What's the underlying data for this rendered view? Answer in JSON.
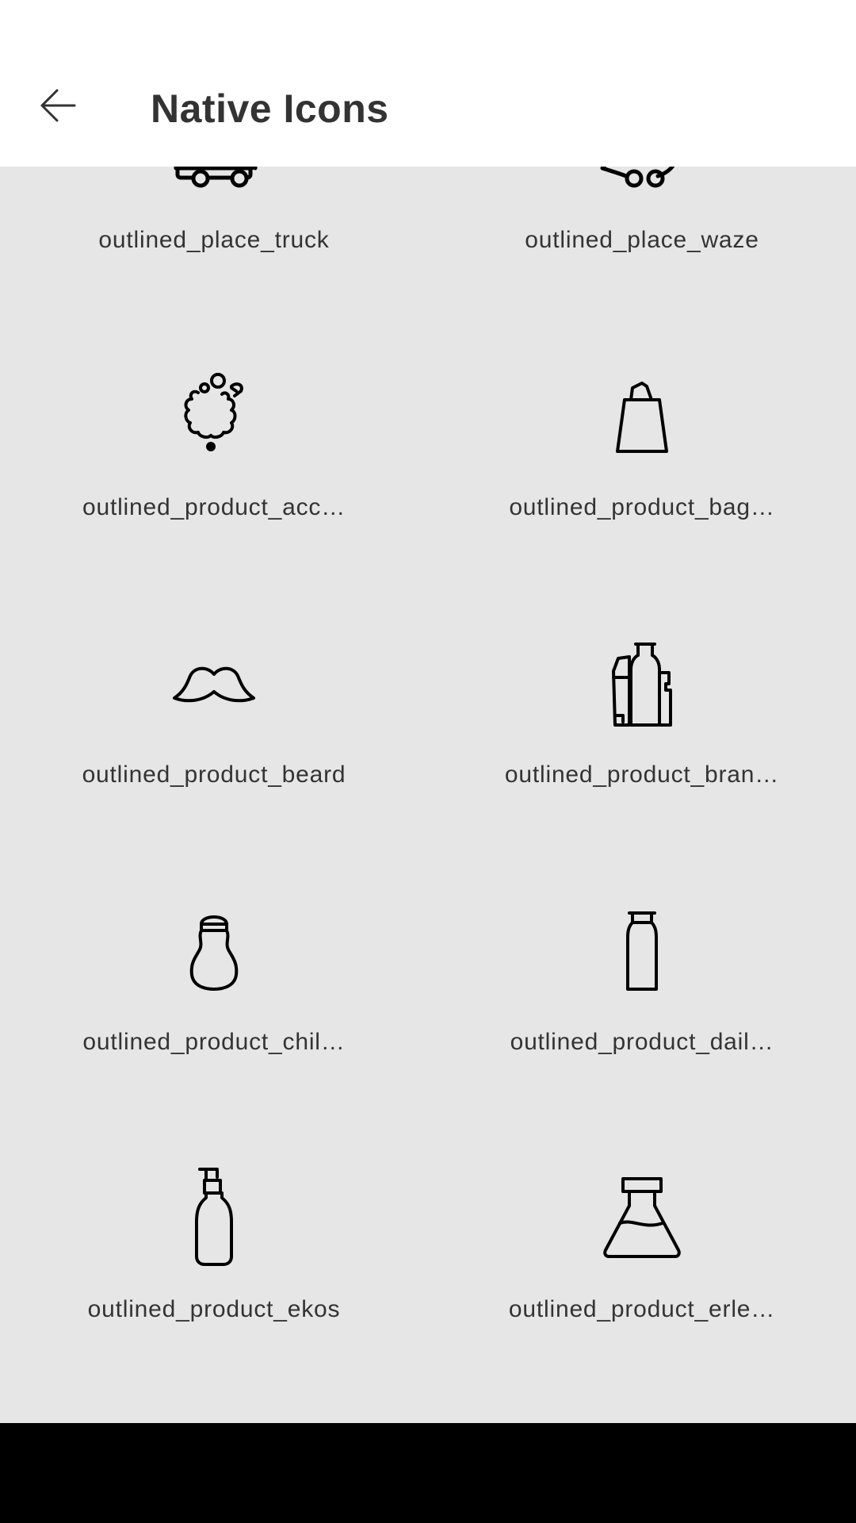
{
  "app_bar": {
    "title": "Native Icons",
    "back_icon": "arrow-left-icon"
  },
  "icons": [
    {
      "label": "outlined_place_truck",
      "icon": "truck-icon"
    },
    {
      "label": "outlined_place_waze",
      "icon": "waze-icon"
    },
    {
      "label": "outlined_product_acc…",
      "icon": "product-accessories-icon"
    },
    {
      "label": "outlined_product_bag…",
      "icon": "product-bag-icon"
    },
    {
      "label": "outlined_product_beard",
      "icon": "beard-icon"
    },
    {
      "label": "outlined_product_bran…",
      "icon": "product-brand-icon"
    },
    {
      "label": "outlined_product_chil…",
      "icon": "product-children-icon"
    },
    {
      "label": "outlined_product_dail…",
      "icon": "product-daily-icon"
    },
    {
      "label": "outlined_product_ekos",
      "icon": "product-ekos-icon"
    },
    {
      "label": "outlined_product_erle…",
      "icon": "erlenmeyer-flask-icon"
    }
  ],
  "colors": {
    "app_bar_bg": "#ffffff",
    "content_bg": "#e6e6e6",
    "text": "#333333",
    "nav_bar": "#000000"
  }
}
